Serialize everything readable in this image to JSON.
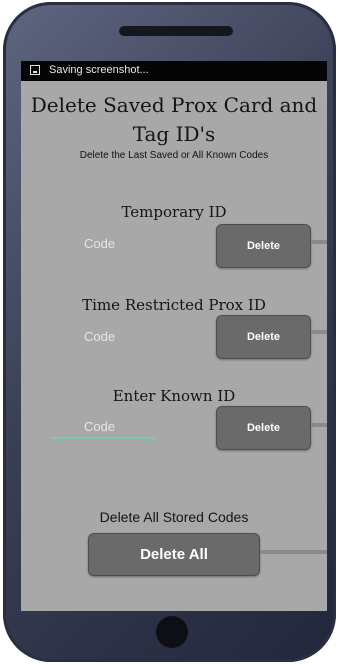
{
  "status": {
    "text": "Saving screenshot..."
  },
  "header": {
    "title_line1": "Delete Saved Prox Card and",
    "title_line2": "Tag ID's",
    "subtitle": "Delete the Last Saved or All Known Codes"
  },
  "sections": [
    {
      "label": "Temporary ID",
      "placeholder": "Code",
      "button": "Delete"
    },
    {
      "label": "Time Restricted Prox ID",
      "placeholder": "Code",
      "button": "Delete"
    },
    {
      "label": "Enter Known ID",
      "placeholder": "Code",
      "button": "Delete"
    }
  ],
  "delete_all": {
    "label": "Delete All Stored Codes",
    "button": "Delete All"
  }
}
